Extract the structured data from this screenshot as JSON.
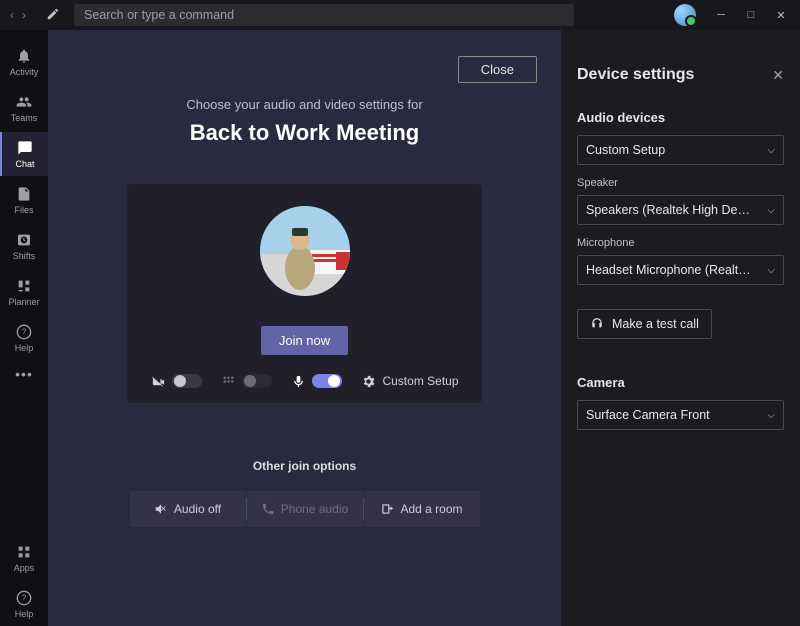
{
  "titlebar": {
    "search_placeholder": "Search or type a command"
  },
  "sidebar": {
    "items": [
      {
        "label": "Activity"
      },
      {
        "label": "Teams"
      },
      {
        "label": "Chat"
      },
      {
        "label": "Files"
      },
      {
        "label": "Shifts"
      },
      {
        "label": "Planner"
      },
      {
        "label": "Help"
      }
    ],
    "bottom": [
      {
        "label": "Apps"
      },
      {
        "label": "Help"
      }
    ]
  },
  "prejoin": {
    "close": "Close",
    "choose": "Choose your audio and video settings for",
    "meeting_title": "Back to Work Meeting",
    "join": "Join now",
    "custom_setup": "Custom Setup",
    "other_header": "Other join options",
    "options": {
      "audio_off": "Audio off",
      "phone_audio": "Phone audio",
      "add_room": "Add a room"
    }
  },
  "panel": {
    "title": "Device settings",
    "audio_hdr": "Audio devices",
    "audio_value": "Custom Setup",
    "speaker_label": "Speaker",
    "speaker_value": "Speakers (Realtek High Definition Au...",
    "mic_label": "Microphone",
    "mic_value": "Headset Microphone (Realtek High D...",
    "test_call": "Make a test call",
    "camera_hdr": "Camera",
    "camera_value": "Surface Camera Front"
  }
}
